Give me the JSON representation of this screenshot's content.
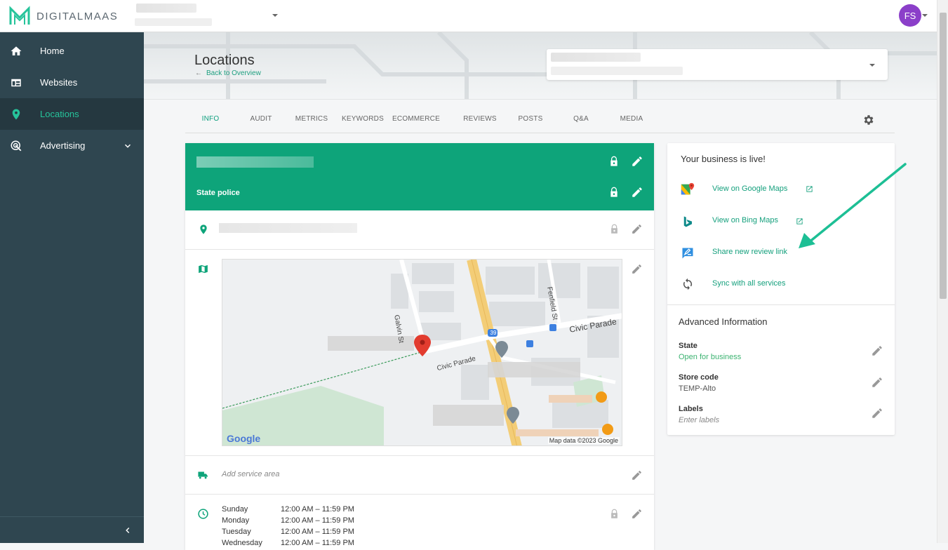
{
  "topbar": {
    "logo_text": "DIGITALMAAS",
    "avatar_initials": "FS"
  },
  "sidebar": {
    "items": [
      {
        "label": "Home",
        "icon": "home-icon"
      },
      {
        "label": "Websites",
        "icon": "website-icon"
      },
      {
        "label": "Locations",
        "icon": "location-pin-icon"
      },
      {
        "label": "Advertising",
        "icon": "target-icon"
      }
    ]
  },
  "header": {
    "title": "Locations",
    "back_link": "Back to Overview"
  },
  "tabs": [
    "INFO",
    "AUDIT",
    "METRICS",
    "KEYWORDS",
    "ECOMMERCE",
    "REVIEWS",
    "POSTS",
    "Q&A",
    "MEDIA"
  ],
  "active_tab": "INFO",
  "main": {
    "category": "State police",
    "service_area_placeholder": "Add service area",
    "map": {
      "streets": [
        "Galvin St",
        "Fenfield St",
        "Civic Parade",
        "Civic Parade"
      ],
      "route_badge": "39",
      "attribution": "Map data ©2023 Google",
      "logo": "Google"
    },
    "hours": [
      {
        "day": "Sunday",
        "time": "12:00 AM – 11:59 PM"
      },
      {
        "day": "Monday",
        "time": "12:00 AM – 11:59 PM"
      },
      {
        "day": "Tuesday",
        "time": "12:00 AM – 11:59 PM"
      },
      {
        "day": "Wednesday",
        "time": "12:00 AM – 11:59 PM"
      }
    ]
  },
  "side": {
    "live_title": "Your business is live!",
    "actions": [
      {
        "label": "View on Google Maps",
        "icon": "google-maps-icon"
      },
      {
        "label": "View on Bing Maps",
        "icon": "bing-icon"
      },
      {
        "label": "Share new review link",
        "icon": "review-link-icon"
      },
      {
        "label": "Sync with all services",
        "icon": "sync-icon"
      }
    ],
    "advanced_title": "Advanced Information",
    "fields": [
      {
        "label": "State",
        "value": "Open for business",
        "value_color": "#3cb371"
      },
      {
        "label": "Store code",
        "value": "TEMP-Alto"
      },
      {
        "label": "Labels",
        "value": "Enter labels"
      }
    ]
  },
  "colors": {
    "brand_green": "#0ea47a",
    "sidebar_bg": "#2f4650",
    "accent_teal": "#26c49b",
    "annotation_arrow": "#1dbf95"
  }
}
